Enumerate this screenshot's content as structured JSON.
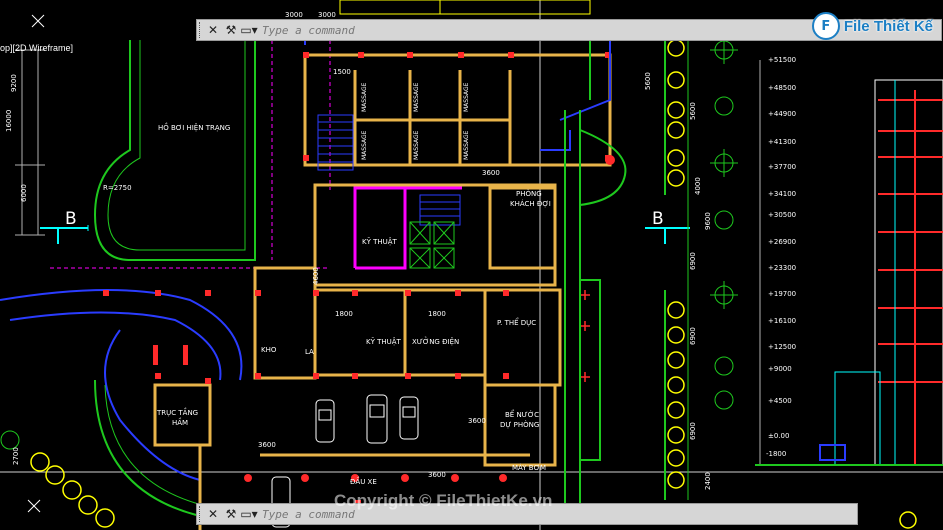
{
  "cad": {
    "viewport_label": "op][2D Wireframe]",
    "command_top": {
      "placeholder": "Type a command"
    },
    "command_bottom": {
      "placeholder": "Type a command"
    },
    "colors": {
      "bg": "#000000",
      "wall": "#e8b44a",
      "magenta": "#ff00ff",
      "green": "#1ec81e",
      "blue": "#2a3cff",
      "red": "#ff2a2a",
      "yellow": "#ffff00",
      "cyan": "#00ffff",
      "white": "#ffffff"
    }
  },
  "logo": {
    "badge": "F",
    "text": "File Thiết Kế"
  },
  "watermark": "Copyright © FileThietKe.vn",
  "rooms": {
    "ho_boi": "HỒ BƠI HIỆN TRẠNG",
    "ky_thuat_1": "KỸ THUẬT",
    "phong_khach_doi": "PHÒNG",
    "phong_khach_doi_2": "KHÁCH ĐỢI",
    "ky_thuat_2": "KỸ THUẬT",
    "xuong_dien": "XƯỞNG ĐIỆN",
    "p_the_duc": "P. THỂ DỤC",
    "kho": "KHO",
    "la": "LA",
    "truc_tang_ham": "TRỤC TẦNG",
    "truc_tang_ham_2": "HẦM",
    "be_nuoc": "BỂ NƯỚC",
    "be_nuoc_2": "DỰ PHÒNG",
    "may_bom": "MÁY BƠM",
    "dau_xe": "ĐẦU XE",
    "massage": "MASSAGE"
  },
  "dims": {
    "d3000": "3000",
    "d1500": "1500",
    "d9200": "9200",
    "d16000": "16000",
    "d6000": "6000",
    "r2750": "R=2750",
    "d3600": "3600",
    "d2700": "2700",
    "d5600": "5600",
    "d4600": "4600",
    "d9600": "9600",
    "d1800": "1800",
    "d6900": "6900",
    "d2400": "2400",
    "d4000": "4000"
  },
  "section_marks": {
    "left": "B",
    "right": "B"
  },
  "elevations": [
    "+51500",
    "+48500",
    "+44900",
    "+41300",
    "+37700",
    "+34100",
    "+30500",
    "+26900",
    "+23300",
    "+19700",
    "+16100",
    "+12500",
    "+9000",
    "+4500",
    "±0.00",
    "-1800"
  ]
}
